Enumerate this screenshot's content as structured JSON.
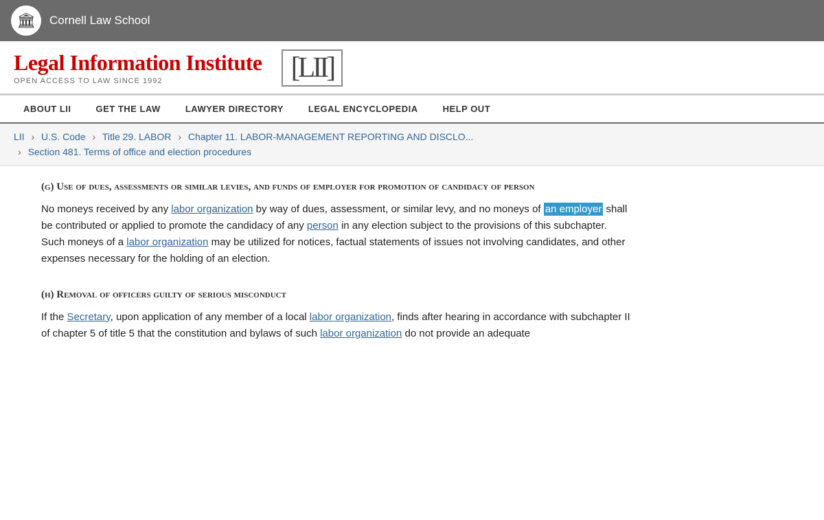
{
  "cornell_bar": {
    "school_name": "Cornell Law School"
  },
  "lii_header": {
    "title": "Legal Information Institute",
    "subtitle": "OPEN ACCESS TO LAW SINCE 1992",
    "logo_text": "[LII]"
  },
  "nav": {
    "items": [
      {
        "label": "ABOUT LII",
        "id": "about-lii"
      },
      {
        "label": "GET THE LAW",
        "id": "get-the-law"
      },
      {
        "label": "LAWYER DIRECTORY",
        "id": "lawyer-directory"
      },
      {
        "label": "LEGAL ENCYCLOPEDIA",
        "id": "legal-encyclopedia"
      },
      {
        "label": "HELP OUT",
        "id": "help-out"
      }
    ]
  },
  "breadcrumb": {
    "items": [
      {
        "label": "LII",
        "href": "#"
      },
      {
        "label": "U.S. Code",
        "href": "#"
      },
      {
        "label": "Title 29. LABOR",
        "href": "#"
      },
      {
        "label": "Chapter 11. LABOR-MANAGEMENT REPORTING AND DISCLO...",
        "href": "#"
      }
    ],
    "current_line2": "Section 481. Terms of office and election procedures"
  },
  "content": {
    "section_g": {
      "heading": "(g) Use of dues, assessments or similar levies, and funds of employer for promotion of candidacy of person",
      "paragraphs": [
        {
          "parts": [
            {
              "type": "text",
              "text": "No moneys received by any "
            },
            {
              "type": "link",
              "text": "labor organization",
              "href": "#"
            },
            {
              "type": "text",
              "text": " by way of dues, assessment, or similar levy, and no moneys of "
            },
            {
              "type": "highlight",
              "text": "an employer"
            },
            {
              "type": "text",
              "text": " shall be contributed or applied to promote the candidacy of any "
            },
            {
              "type": "link",
              "text": "person",
              "href": "#"
            },
            {
              "type": "text",
              "text": " in any election subject to the provisions of this subchapter. Such moneys of a "
            },
            {
              "type": "link",
              "text": "labor organization",
              "href": "#"
            },
            {
              "type": "text",
              "text": " may be utilized for notices, factual statements of issues not involving candidates, and other expenses necessary for the holding of an election."
            }
          ]
        }
      ]
    },
    "section_h": {
      "heading": "(h) Removal of officers guilty of serious misconduct",
      "paragraphs": [
        {
          "parts": [
            {
              "type": "text",
              "text": "If the "
            },
            {
              "type": "link",
              "text": "Secretary",
              "href": "#"
            },
            {
              "type": "text",
              "text": ", upon application of any member of a local "
            },
            {
              "type": "link",
              "text": "labor organization",
              "href": "#"
            },
            {
              "type": "text",
              "text": ", finds after hearing in accordance with subchapter II of chapter 5 of title 5 that the constitution and bylaws of such "
            },
            {
              "type": "link",
              "text": "labor organization",
              "href": "#"
            },
            {
              "type": "text",
              "text": " do not provide an adequate"
            }
          ]
        }
      ]
    }
  }
}
